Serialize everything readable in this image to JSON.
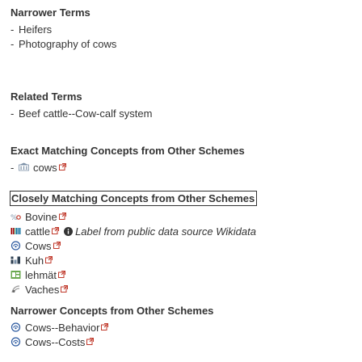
{
  "narrower_terms": {
    "heading": "Narrower Terms",
    "items": [
      {
        "label": "Heifers"
      },
      {
        "label": "Photography of cows"
      }
    ]
  },
  "related_terms": {
    "heading": "Related Terms",
    "items": [
      {
        "label": "Beef cattle--Cow-calf system"
      }
    ]
  },
  "exact_matching": {
    "heading": "Exact Matching Concepts from Other Schemes",
    "items": [
      {
        "label": "cows",
        "icon": "lcsh-icon"
      }
    ]
  },
  "closely_matching": {
    "heading": "Closely Matching Concepts from Other Schemes",
    "items": [
      {
        "label": "Bovine",
        "icon": "source-icon-red"
      },
      {
        "label": "cattle",
        "icon": "wikidata-icon",
        "note": "Label from public data source Wikidata"
      },
      {
        "label": "Cows",
        "icon": "scheme-icon-blue"
      },
      {
        "label": "Kuh",
        "icon": "source-icon-dnb"
      },
      {
        "label": "lehmät",
        "icon": "source-icon-green"
      },
      {
        "label": "Vaches",
        "icon": "source-icon-ram"
      }
    ]
  },
  "narrower_other": {
    "heading": "Narrower Concepts from Other Schemes",
    "items": [
      {
        "label": "Cows--Behavior",
        "icon": "scheme-icon-blue"
      },
      {
        "label": "Cows--Costs",
        "icon": "scheme-icon-blue"
      }
    ]
  },
  "colors": {
    "text": "#333333",
    "external_link": "#c0392b",
    "wikidata_red": "#990000",
    "wikidata_green": "#339966",
    "wikidata_blue": "#006699",
    "scheme_blue": "#2c5aa0"
  }
}
